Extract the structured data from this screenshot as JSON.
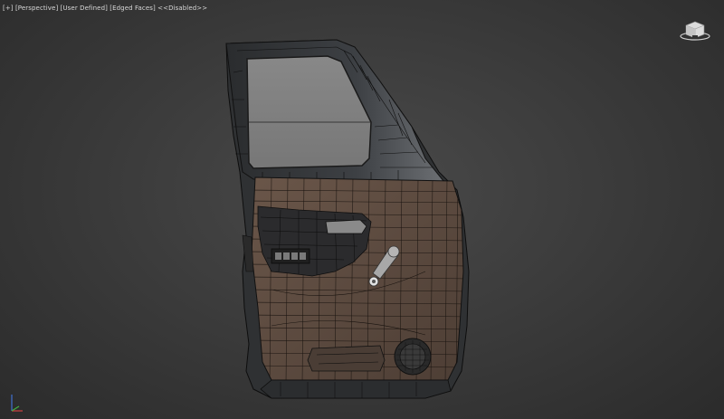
{
  "viewport": {
    "labels": [
      "[+]",
      "[Perspective]",
      "[User Defined]",
      "[Edged Faces]",
      "<<Disabled>>"
    ]
  },
  "scene": {
    "object": "car-door",
    "colors": {
      "background": "#3c3c3c",
      "panel": "#5b4a40",
      "glass": "#7d7d7d",
      "frame": "#2c2e30",
      "wire": "#0d0d0d",
      "handle": "#9a9a9a"
    }
  },
  "gizmo": {
    "x_color": "#d04040",
    "y_color": "#40b040",
    "z_color": "#4070d0"
  }
}
